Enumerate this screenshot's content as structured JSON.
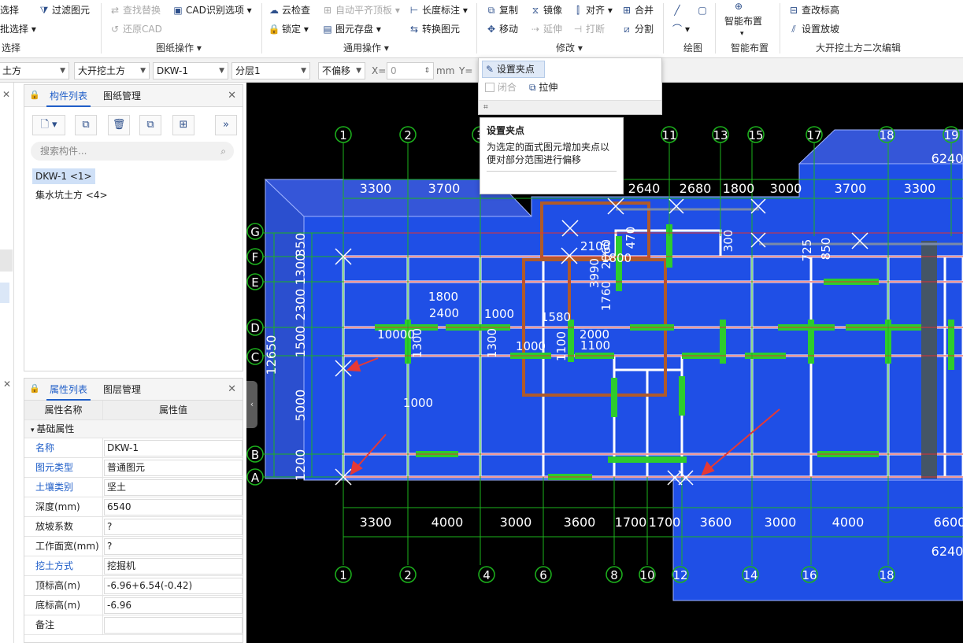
{
  "colors": {
    "canvas_bg": "#000000",
    "slab_blue": "#1f4fe6",
    "accent": "#1f5ec8",
    "arrow_red": "#e53935",
    "axis_green": "#1db31d",
    "rebar_green": "#2dcc2d"
  },
  "ribbon": {
    "select_item": "选择",
    "filter_item": "过滤图元",
    "batch_select": "批选择",
    "find_replace": "查找替换",
    "cad_options": "CAD识别选项",
    "restore_cad": "还原CAD",
    "group_drawing_ops": "图纸操作",
    "group_select": "选择",
    "cloud_check": "云检查",
    "auto_flush": "自动平齐顶板",
    "length_dim": "长度标注",
    "lock": "锁定",
    "elem_save": "图元存盘",
    "convert_elem": "转换图元",
    "group_general": "通用操作",
    "copy": "复制",
    "mirror": "镜像",
    "align": "对齐",
    "merge": "合并",
    "move": "移动",
    "extend": "延伸",
    "break": "打断",
    "split": "分割",
    "group_modify": "修改",
    "group_draw": "绘图",
    "smart_layout": "智能布置",
    "group_smart": "智能布置",
    "check_elev": "查改标高",
    "set_slope": "设置放坡",
    "group_secondary": "大开挖土方二次编辑"
  },
  "toolbar": {
    "sel1": "土方",
    "sel2": "大开挖土方",
    "sel3": "DKW-1",
    "sel4": "分层1",
    "offset": "不偏移",
    "x_label": "X=",
    "x_value": "0",
    "unit": "mm",
    "y_label": "Y="
  },
  "component_panel": {
    "tab_list": "构件列表",
    "tab_drawings": "图纸管理",
    "search_placeholder": "搜索构件...",
    "items": [
      "DKW-1 <1>",
      "集水坑土方 <4>"
    ]
  },
  "property_panel": {
    "tab_props": "属性列表",
    "tab_layers": "图层管理",
    "col_name": "属性名称",
    "col_value": "属性值",
    "section": "基础属性",
    "rows": [
      {
        "name": "名称",
        "value": "DKW-1"
      },
      {
        "name": "图元类型",
        "value": "普通图元"
      },
      {
        "name": "土壤类别",
        "value": "坚土"
      },
      {
        "name": "深度(mm)",
        "value": "6540"
      },
      {
        "name": "放坡系数",
        "value": "?"
      },
      {
        "name": "工作面宽(mm)",
        "value": "?"
      },
      {
        "name": "挖土方式",
        "value": "挖掘机"
      },
      {
        "name": "顶标高(m)",
        "value": "-6.96+6.54(-0.42)"
      },
      {
        "name": "底标高(m)",
        "value": "-6.96"
      },
      {
        "name": "备注",
        "value": ""
      }
    ]
  },
  "popup": {
    "set_grip": "设置夹点",
    "close": "闭合",
    "stretch": "拉伸"
  },
  "tooltip": {
    "title": "设置夹点",
    "desc": "为选定的面式图元增加夹点以便对部分范围进行偏移"
  },
  "drawing": {
    "axes_top": [
      "1",
      "2",
      "3",
      "11",
      "13",
      "15",
      "17",
      "18",
      "19"
    ],
    "axes_bottom": [
      "1",
      "2",
      "4",
      "6",
      "8",
      "10",
      "12",
      "14",
      "16",
      "18"
    ],
    "axes_left": [
      "G",
      "F",
      "E",
      "D",
      "C",
      "B",
      "A"
    ],
    "dims_top": [
      "3300",
      "3700",
      "2640",
      "2680",
      "1800",
      "3000",
      "3700",
      "3300",
      "6240"
    ],
    "dims_bottom": [
      "3300",
      "4000",
      "3000",
      "3600",
      "1700",
      "1700",
      "3600",
      "3000",
      "4000",
      "6600",
      "6240"
    ],
    "dims_left": [
      "350",
      "1300",
      "2300",
      "1500",
      "5000",
      "1200"
    ],
    "dim_total_left": "12650",
    "inner_labels": [
      "1800",
      "2400",
      "1000",
      "10000",
      "1300",
      "1300",
      "1000",
      "1580",
      "1100",
      "2000",
      "1100",
      "2100",
      "3990",
      "1760",
      "2060",
      "1800",
      "470",
      "300",
      "725",
      "850",
      "1000",
      "2100",
      "1000"
    ]
  }
}
